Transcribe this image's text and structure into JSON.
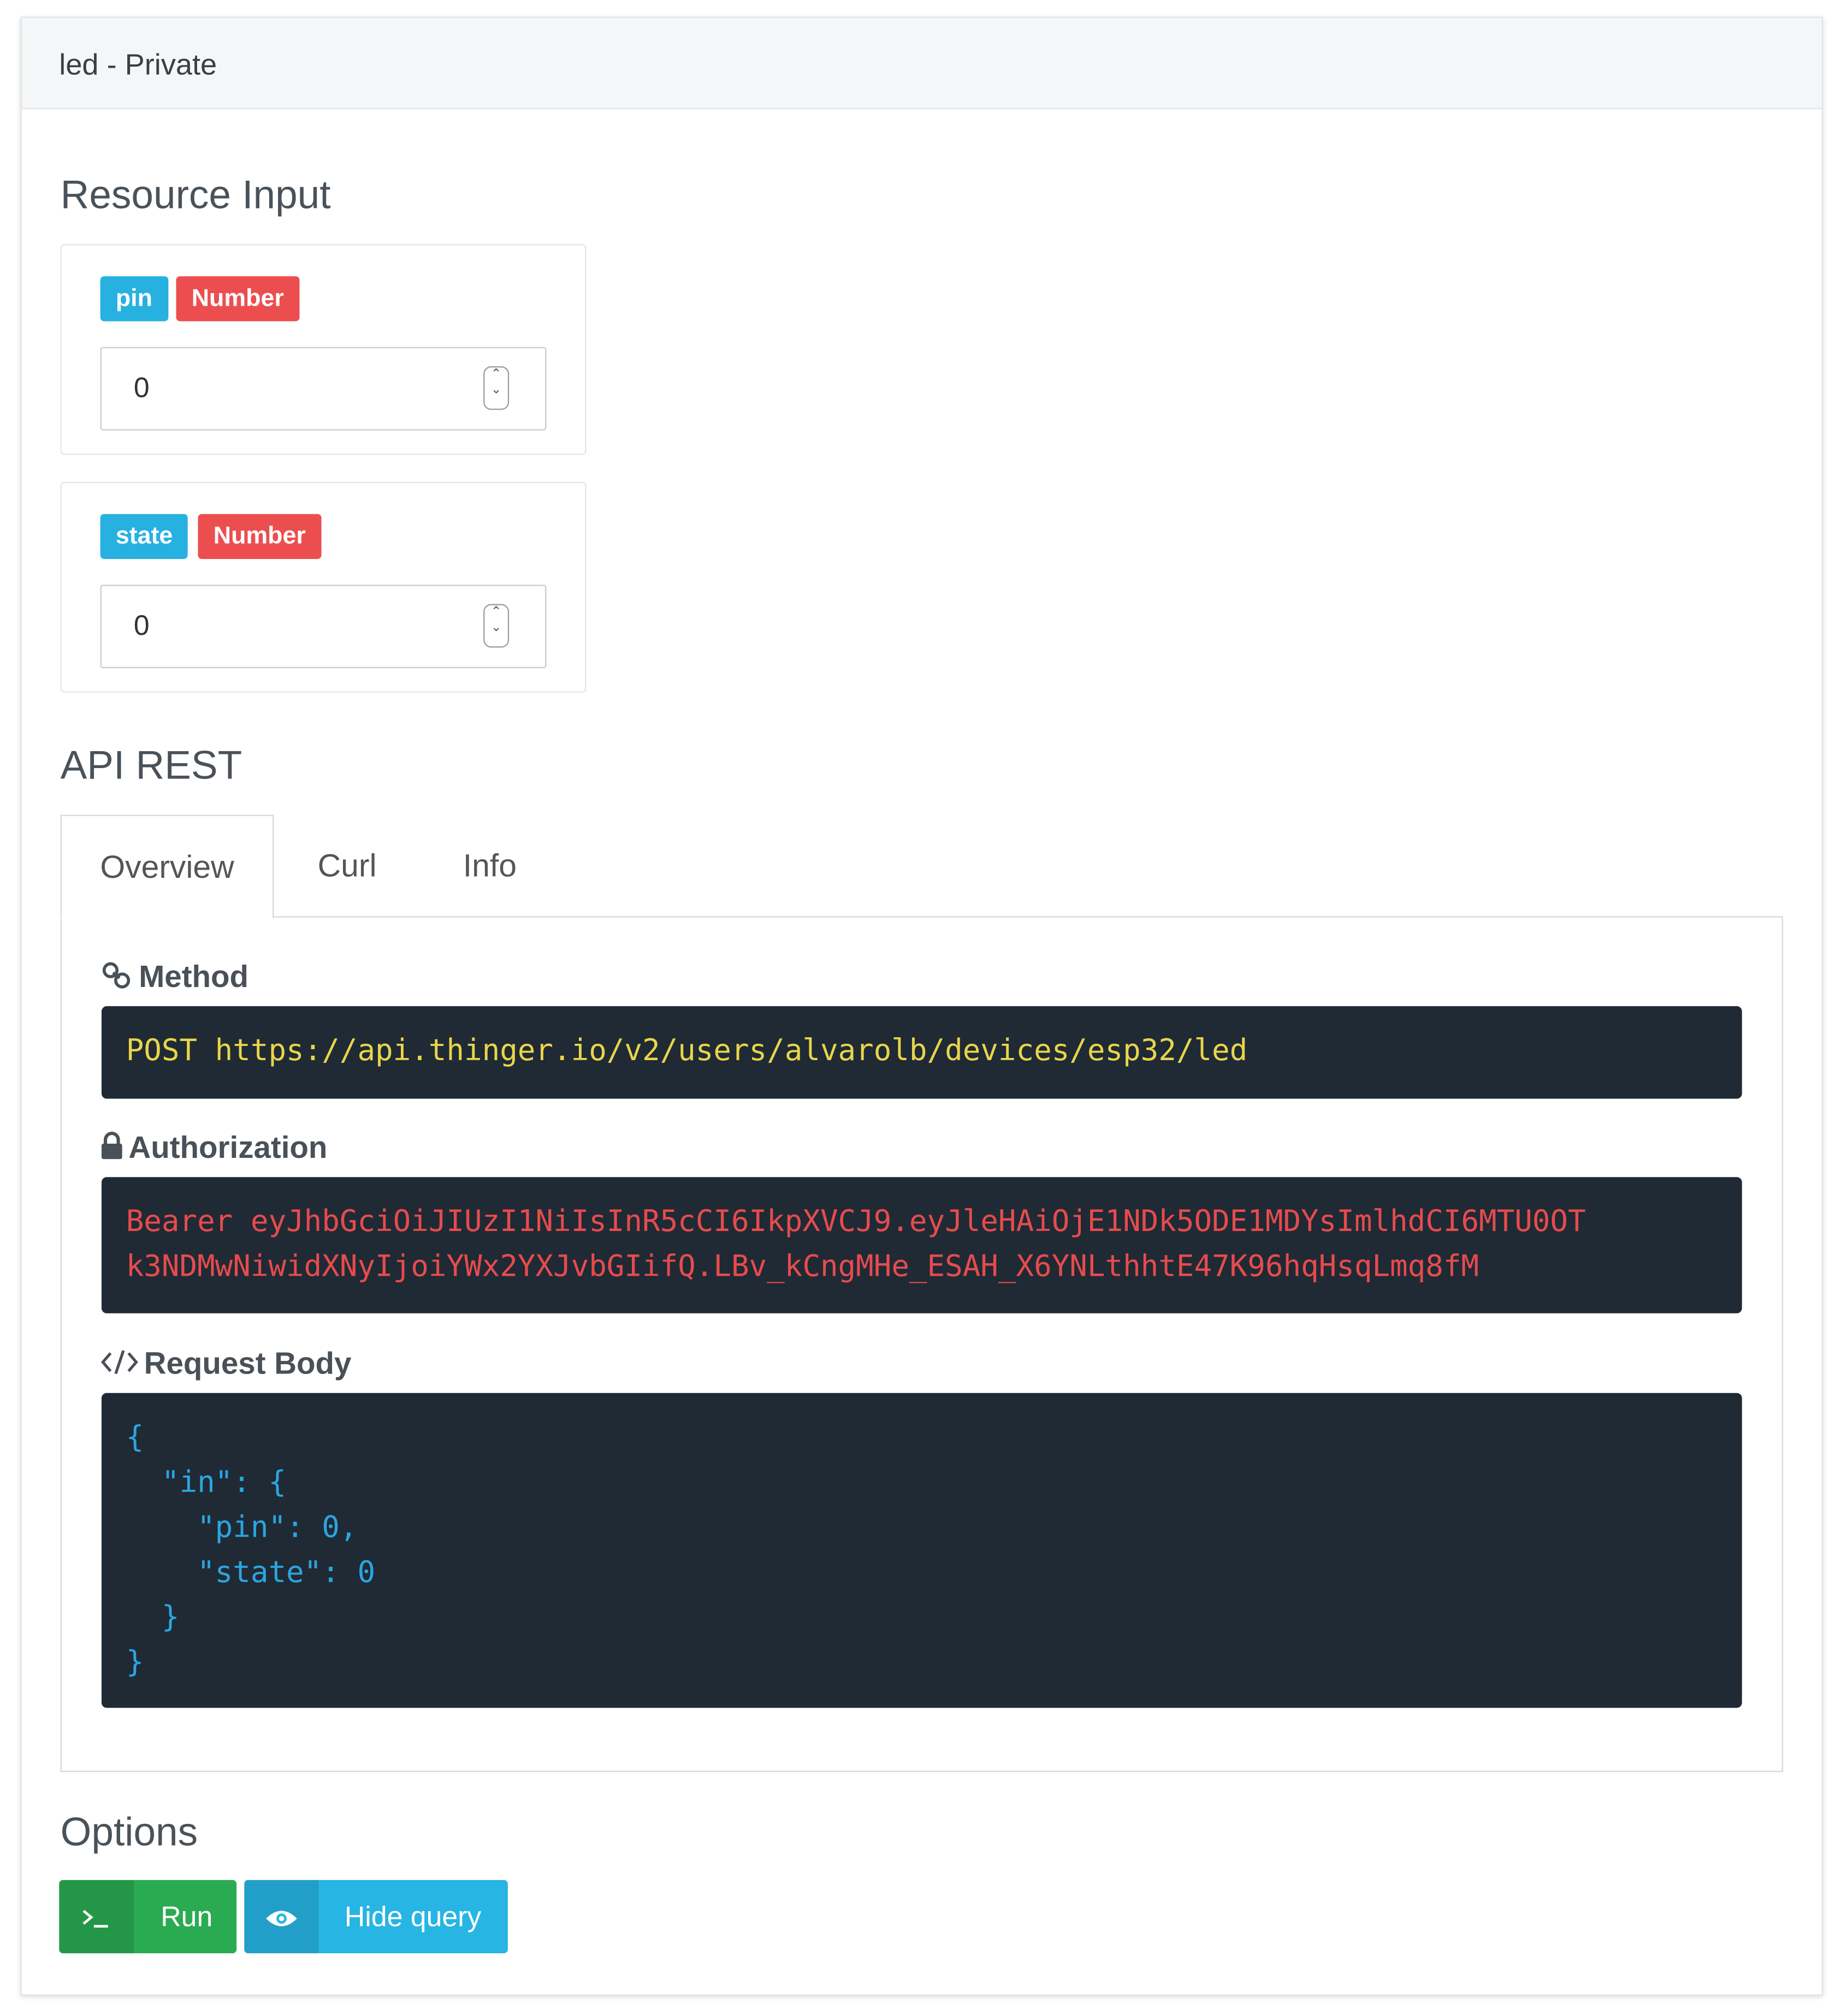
{
  "panel": {
    "title": "led - Private"
  },
  "resource_input": {
    "title": "Resource Input",
    "params": [
      {
        "name": "pin",
        "type": "Number",
        "value": "0"
      },
      {
        "name": "state",
        "type": "Number",
        "value": "0"
      }
    ]
  },
  "api_rest": {
    "title": "API REST",
    "tabs": [
      {
        "label": "Overview",
        "active": true
      },
      {
        "label": "Curl",
        "active": false
      },
      {
        "label": "Info",
        "active": false
      }
    ],
    "method": {
      "label": "Method",
      "icon": "link-icon",
      "value": "POST https://api.thinger.io/v2/users/alvarolb/devices/esp32/led"
    },
    "authorization": {
      "label": "Authorization",
      "icon": "lock-icon",
      "value": "Bearer eyJhbGciOiJIUzI1NiIsInR5cCI6IkpXVCJ9.eyJleHAiOjE1NDk5ODE1MDYsImlhdCI6MTU0OT\nk3NDMwNiwidXNyIjoiYWx2YXJvbGIifQ.LBv_kCngMHe_ESAH_X6YNLthhtE47K96hqHsqLmq8fM"
    },
    "request_body": {
      "label": "Request Body",
      "icon": "code-icon",
      "value": "{\n  \"in\": {\n    \"pin\": 0,\n    \"state\": 0\n  }\n}"
    }
  },
  "options": {
    "title": "Options",
    "run_label": "Run",
    "run_icon": "terminal-icon",
    "hide_query_label": "Hide query",
    "hide_query_icon": "eye-icon"
  },
  "colors": {
    "tag_name": "#26b1e1",
    "tag_type": "#ec4e50",
    "code_bg": "#1f2a35",
    "method_text": "#e8d54a",
    "auth_text": "#e74b4d",
    "body_text": "#2ca5e0",
    "run_button": "#2aab52",
    "hide_button": "#27b5e4"
  }
}
